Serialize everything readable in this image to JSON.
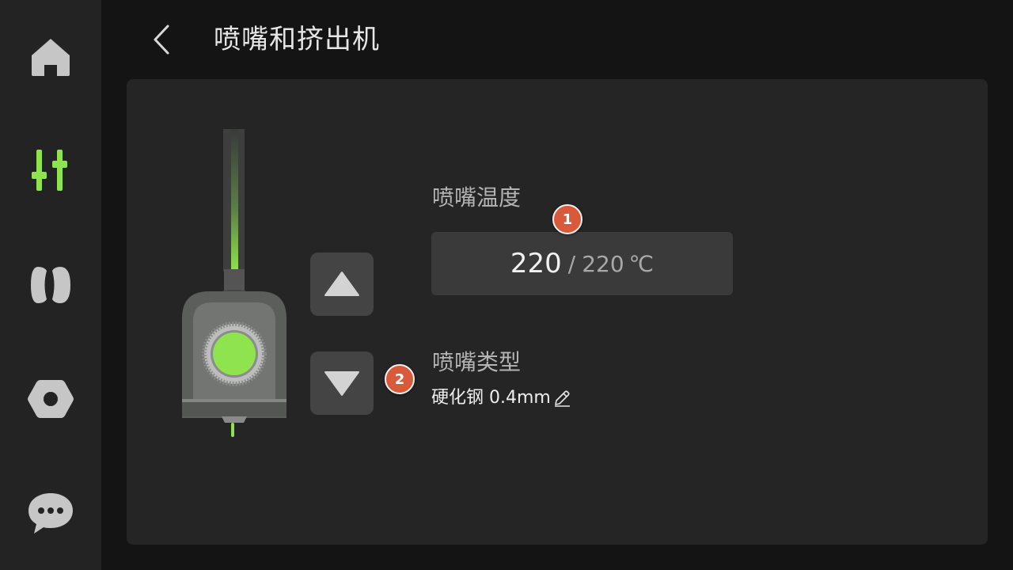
{
  "header": {
    "title": "喷嘴和挤出机"
  },
  "sidebar": {
    "items": [
      {
        "icon": "home-icon",
        "active": false
      },
      {
        "icon": "sliders-icon",
        "active": true
      },
      {
        "icon": "filament-spool-icon",
        "active": false
      },
      {
        "icon": "hex-nut-icon",
        "active": false
      },
      {
        "icon": "chat-icon",
        "active": false
      }
    ]
  },
  "nozzle": {
    "temp_label": "喷嘴温度",
    "current_temp": "220",
    "separator": "/",
    "target_temp": "220",
    "unit": "℃",
    "type_label": "喷嘴类型",
    "type_value": "硬化钢 0.4mm"
  },
  "badges": {
    "first": "1",
    "second": "2"
  },
  "colors": {
    "accent": "#8ee34f",
    "badge": "#d9593b",
    "panel": "#252525",
    "sidebar": "#232323"
  }
}
